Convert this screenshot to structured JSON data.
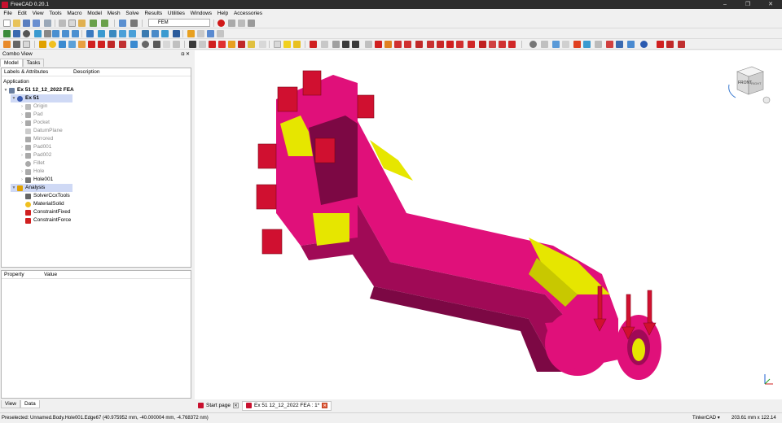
{
  "window": {
    "title": "FreeCAD 0.20.1",
    "controls": [
      "–",
      "❐",
      "✕"
    ]
  },
  "menu": [
    "File",
    "Edit",
    "View",
    "Tools",
    "Macro",
    "Model",
    "Mesh",
    "Solve",
    "Results",
    "Utilities",
    "Windows",
    "Help",
    "Accessories"
  ],
  "toolbar": {
    "workbench": "FEM"
  },
  "combo_view": {
    "title": "Combo View",
    "tabs": [
      "Model",
      "Tasks"
    ],
    "columns": [
      "Labels & Attributes",
      "Description"
    ],
    "root_label": "Application",
    "items": [
      {
        "label": "Ex 51 12_12_2022 FEA"
      },
      {
        "label": "Ex 51"
      },
      {
        "label": "Origin"
      },
      {
        "label": "Pad"
      },
      {
        "label": "Pocket"
      },
      {
        "label": "DatumPlane"
      },
      {
        "label": "Mirrored"
      },
      {
        "label": "Pad001"
      },
      {
        "label": "Pad002"
      },
      {
        "label": "Fillet"
      },
      {
        "label": "Hole"
      },
      {
        "label": "Hole001"
      },
      {
        "label": "Analysis"
      },
      {
        "label": "SolverCcxTools"
      },
      {
        "label": "MaterialSolid"
      },
      {
        "label": "ConstraintFixed"
      },
      {
        "label": "ConstraintForce"
      }
    ]
  },
  "properties": {
    "columns": [
      "Property",
      "Value"
    ]
  },
  "bottom_tabs": [
    "View",
    "Data"
  ],
  "doc_tabs": [
    {
      "label": "Start page"
    },
    {
      "label": "Ex 51 12_12_2022 FEA : 1*"
    }
  ],
  "navcube": {
    "front_label": "FRONT",
    "right_label": "RIGHT"
  },
  "status": {
    "message": "Preselected: Unnamed.Body.Hole001.Edge67 (40.975952 mm, -40.000004 mm, -4.768372 nm)",
    "navigation": "TinkerCAD ▾",
    "dimensions": "203.61 mm x 122.14 mm"
  },
  "colors": {
    "part": "#e0107a",
    "part_dark": "#a00a56",
    "part_shadow": "#7c0844",
    "face_yellow": "#e6e600",
    "constraint": "#d01030",
    "accent": "#c8102e"
  }
}
